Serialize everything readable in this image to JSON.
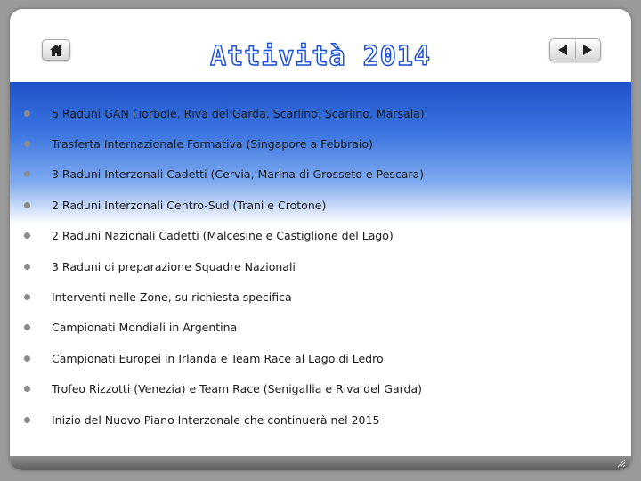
{
  "slide": {
    "title": "Attività 2014",
    "items": [
      "5 Raduni GAN (Torbole, Riva del Garda, Scarlino, Scarlino, Marsala)",
      "Trasferta Internazionale Formativa (Singapore a Febbraio)",
      "3 Raduni Interzonali Cadetti (Cervia, Marina di Grosseto e Pescara)",
      "2 Raduni Interzonali Centro-Sud (Trani e Crotone)",
      "2 Raduni Nazionali Cadetti (Malcesine e Castiglione del Lago)",
      "3 Raduni di preparazione Squadre Nazionali",
      "Interventi nelle Zone, su richiesta specifica",
      "Campionati Mondiali in Argentina",
      "Campionati Europei in Irlanda e Team Race al Lago di Ledro",
      "Trofeo Rizzotti (Venezia) e Team Race (Senigallia e Riva del Garda)",
      "Inizio del Nuovo Piano Interzonale che continuerà nel 2015"
    ]
  },
  "icons": {
    "home": "home-icon",
    "prev": "triangle-left-icon",
    "next": "triangle-right-icon"
  },
  "colors": {
    "title_outline": "#1e4fd0",
    "band_top": "#1f52c8",
    "bullet": "#8a8a8a"
  }
}
